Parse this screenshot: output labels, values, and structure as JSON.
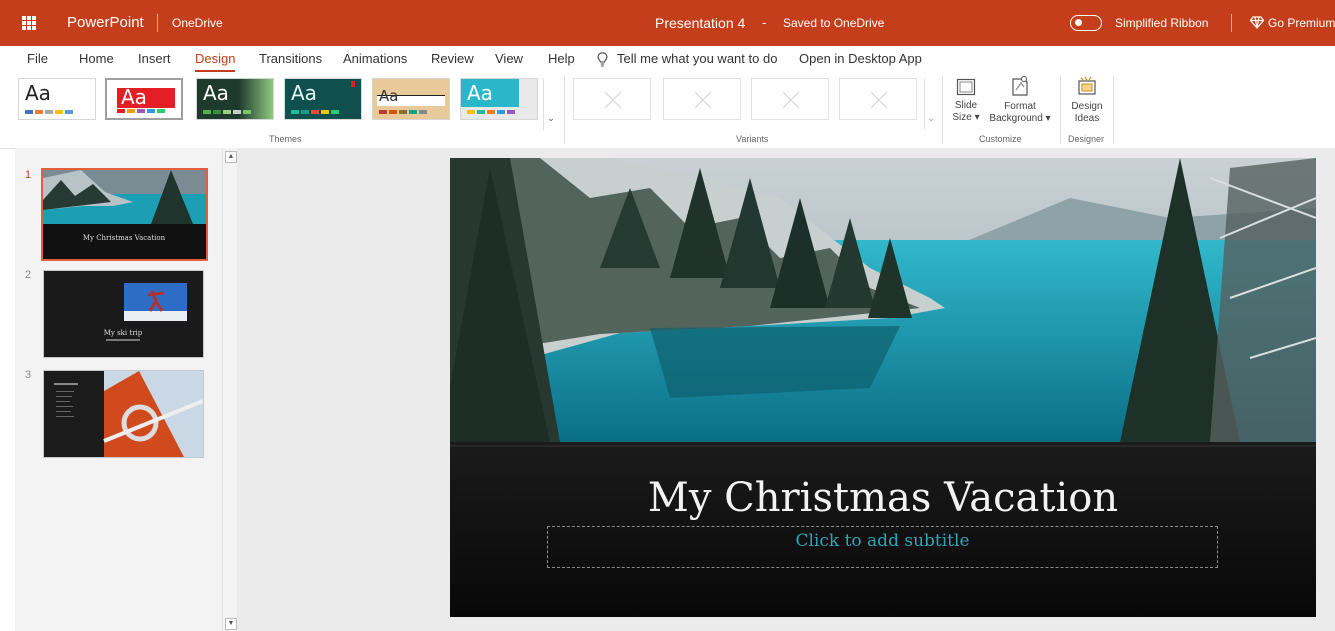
{
  "titlebar": {
    "app_name": "PowerPoint",
    "service": "OneDrive",
    "doc_title": "Presentation 4",
    "separator": "-",
    "save_status": "Saved to OneDrive",
    "simplified_ribbon": "Simplified Ribbon",
    "go_premium": "Go Premium"
  },
  "menu": {
    "items": [
      "File",
      "Home",
      "Insert",
      "Design",
      "Transitions",
      "Animations",
      "Review",
      "View",
      "Help"
    ],
    "active": "Design",
    "tell_me": "Tell me what you want to do",
    "open_desktop": "Open in Desktop App"
  },
  "ribbon": {
    "themes_label": "Themes",
    "variants_label": "Variants",
    "customize_label": "Customize",
    "designer_label": "Designer",
    "theme_sample_text": "Aa",
    "slide_size": [
      "Slide",
      "Size ▾"
    ],
    "format_background": [
      "Format",
      "Background ▾"
    ],
    "design_ideas": [
      "Design",
      "Ideas"
    ]
  },
  "slides": [
    {
      "number": "1",
      "title": "My Christmas Vacation"
    },
    {
      "number": "2",
      "title": "My ski trip"
    },
    {
      "number": "3",
      "title": ""
    }
  ],
  "main_slide": {
    "title": "My Christmas Vacation",
    "subtitle_placeholder": "Click to add subtitle"
  },
  "colors": {
    "brand": "#c43e1c",
    "subtitle": "#2fa6b8"
  }
}
